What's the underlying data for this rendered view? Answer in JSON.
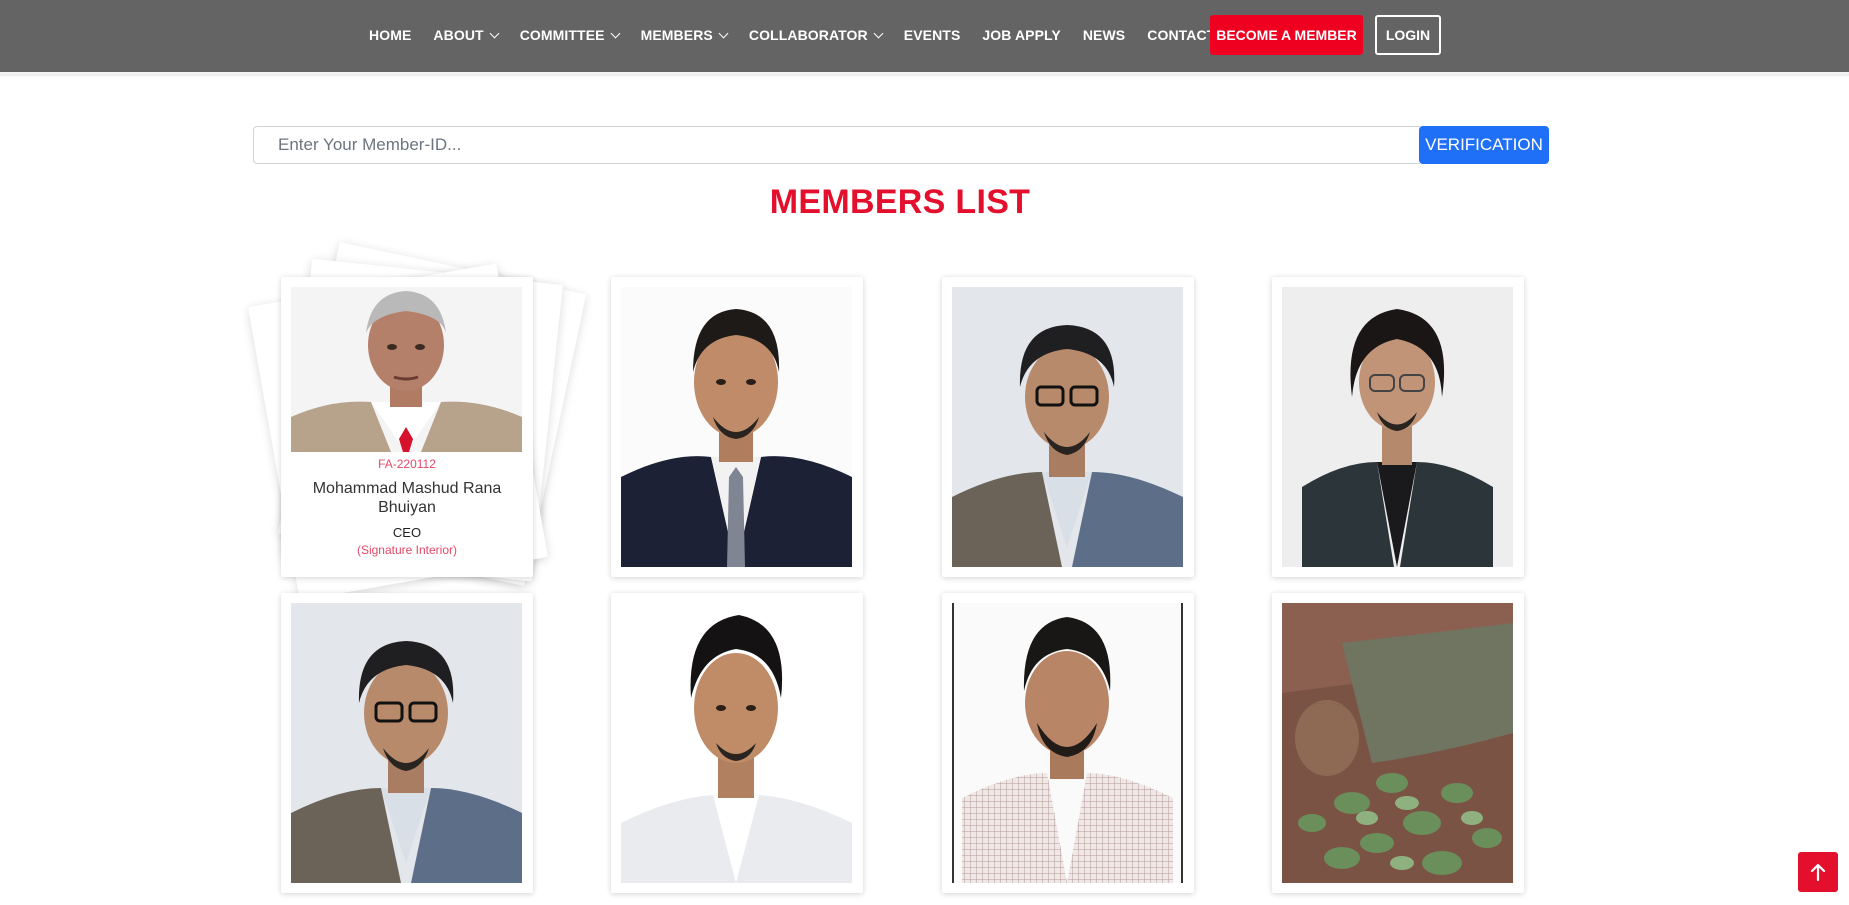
{
  "nav": {
    "items": [
      {
        "label": "HOME",
        "dropdown": false
      },
      {
        "label": "ABOUT",
        "dropdown": true
      },
      {
        "label": "COMMITTEE",
        "dropdown": true
      },
      {
        "label": "MEMBERS",
        "dropdown": true
      },
      {
        "label": "COLLABORATOR",
        "dropdown": true
      },
      {
        "label": "EVENTS",
        "dropdown": false
      },
      {
        "label": "JOB APPLY",
        "dropdown": false
      },
      {
        "label": "NEWS",
        "dropdown": false
      },
      {
        "label": "CONTACT",
        "dropdown": false
      }
    ],
    "become_member": "BECOME A MEMBER",
    "login": "LOGIN"
  },
  "search": {
    "placeholder": "Enter Your Member-ID...",
    "button": "VERIFICATION"
  },
  "title": "MEMBERS LIST",
  "featured_member": {
    "id": "FA-220112",
    "name": "Mohammad Mashud Rana Bhuiyan",
    "role": "CEO",
    "company": "(Signature Interior)"
  },
  "colors": {
    "navbar": "#646464",
    "accent_red": "#f00020",
    "title_red": "#e30f2d",
    "verify_blue": "#1f6ff7"
  },
  "icons": {
    "scroll_top": "arrow-up-icon",
    "dropdown": "chevron-down-icon"
  }
}
